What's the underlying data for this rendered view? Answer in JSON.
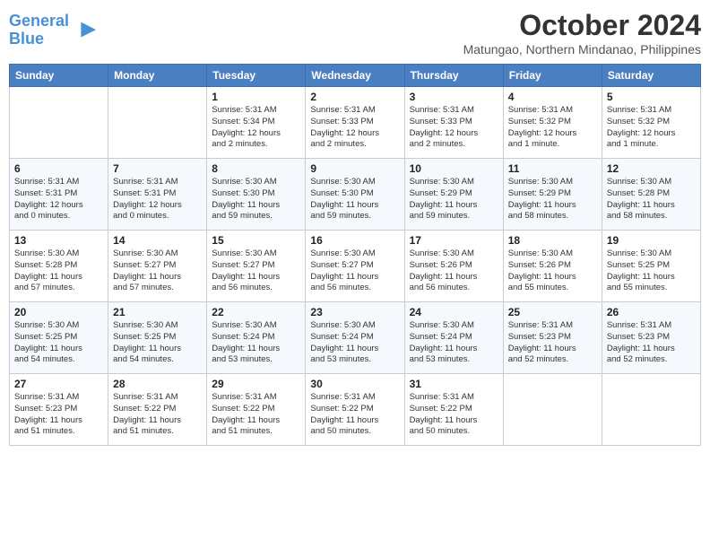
{
  "header": {
    "logo_line1": "General",
    "logo_line2": "Blue",
    "month_year": "October 2024",
    "location": "Matungao, Northern Mindanao, Philippines"
  },
  "days_of_week": [
    "Sunday",
    "Monday",
    "Tuesday",
    "Wednesday",
    "Thursday",
    "Friday",
    "Saturday"
  ],
  "weeks": [
    [
      {
        "day": "",
        "info": ""
      },
      {
        "day": "",
        "info": ""
      },
      {
        "day": "1",
        "info": "Sunrise: 5:31 AM\nSunset: 5:34 PM\nDaylight: 12 hours\nand 2 minutes."
      },
      {
        "day": "2",
        "info": "Sunrise: 5:31 AM\nSunset: 5:33 PM\nDaylight: 12 hours\nand 2 minutes."
      },
      {
        "day": "3",
        "info": "Sunrise: 5:31 AM\nSunset: 5:33 PM\nDaylight: 12 hours\nand 2 minutes."
      },
      {
        "day": "4",
        "info": "Sunrise: 5:31 AM\nSunset: 5:32 PM\nDaylight: 12 hours\nand 1 minute."
      },
      {
        "day": "5",
        "info": "Sunrise: 5:31 AM\nSunset: 5:32 PM\nDaylight: 12 hours\nand 1 minute."
      }
    ],
    [
      {
        "day": "6",
        "info": "Sunrise: 5:31 AM\nSunset: 5:31 PM\nDaylight: 12 hours\nand 0 minutes."
      },
      {
        "day": "7",
        "info": "Sunrise: 5:31 AM\nSunset: 5:31 PM\nDaylight: 12 hours\nand 0 minutes."
      },
      {
        "day": "8",
        "info": "Sunrise: 5:30 AM\nSunset: 5:30 PM\nDaylight: 11 hours\nand 59 minutes."
      },
      {
        "day": "9",
        "info": "Sunrise: 5:30 AM\nSunset: 5:30 PM\nDaylight: 11 hours\nand 59 minutes."
      },
      {
        "day": "10",
        "info": "Sunrise: 5:30 AM\nSunset: 5:29 PM\nDaylight: 11 hours\nand 59 minutes."
      },
      {
        "day": "11",
        "info": "Sunrise: 5:30 AM\nSunset: 5:29 PM\nDaylight: 11 hours\nand 58 minutes."
      },
      {
        "day": "12",
        "info": "Sunrise: 5:30 AM\nSunset: 5:28 PM\nDaylight: 11 hours\nand 58 minutes."
      }
    ],
    [
      {
        "day": "13",
        "info": "Sunrise: 5:30 AM\nSunset: 5:28 PM\nDaylight: 11 hours\nand 57 minutes."
      },
      {
        "day": "14",
        "info": "Sunrise: 5:30 AM\nSunset: 5:27 PM\nDaylight: 11 hours\nand 57 minutes."
      },
      {
        "day": "15",
        "info": "Sunrise: 5:30 AM\nSunset: 5:27 PM\nDaylight: 11 hours\nand 56 minutes."
      },
      {
        "day": "16",
        "info": "Sunrise: 5:30 AM\nSunset: 5:27 PM\nDaylight: 11 hours\nand 56 minutes."
      },
      {
        "day": "17",
        "info": "Sunrise: 5:30 AM\nSunset: 5:26 PM\nDaylight: 11 hours\nand 56 minutes."
      },
      {
        "day": "18",
        "info": "Sunrise: 5:30 AM\nSunset: 5:26 PM\nDaylight: 11 hours\nand 55 minutes."
      },
      {
        "day": "19",
        "info": "Sunrise: 5:30 AM\nSunset: 5:25 PM\nDaylight: 11 hours\nand 55 minutes."
      }
    ],
    [
      {
        "day": "20",
        "info": "Sunrise: 5:30 AM\nSunset: 5:25 PM\nDaylight: 11 hours\nand 54 minutes."
      },
      {
        "day": "21",
        "info": "Sunrise: 5:30 AM\nSunset: 5:25 PM\nDaylight: 11 hours\nand 54 minutes."
      },
      {
        "day": "22",
        "info": "Sunrise: 5:30 AM\nSunset: 5:24 PM\nDaylight: 11 hours\nand 53 minutes."
      },
      {
        "day": "23",
        "info": "Sunrise: 5:30 AM\nSunset: 5:24 PM\nDaylight: 11 hours\nand 53 minutes."
      },
      {
        "day": "24",
        "info": "Sunrise: 5:30 AM\nSunset: 5:24 PM\nDaylight: 11 hours\nand 53 minutes."
      },
      {
        "day": "25",
        "info": "Sunrise: 5:31 AM\nSunset: 5:23 PM\nDaylight: 11 hours\nand 52 minutes."
      },
      {
        "day": "26",
        "info": "Sunrise: 5:31 AM\nSunset: 5:23 PM\nDaylight: 11 hours\nand 52 minutes."
      }
    ],
    [
      {
        "day": "27",
        "info": "Sunrise: 5:31 AM\nSunset: 5:23 PM\nDaylight: 11 hours\nand 51 minutes."
      },
      {
        "day": "28",
        "info": "Sunrise: 5:31 AM\nSunset: 5:22 PM\nDaylight: 11 hours\nand 51 minutes."
      },
      {
        "day": "29",
        "info": "Sunrise: 5:31 AM\nSunset: 5:22 PM\nDaylight: 11 hours\nand 51 minutes."
      },
      {
        "day": "30",
        "info": "Sunrise: 5:31 AM\nSunset: 5:22 PM\nDaylight: 11 hours\nand 50 minutes."
      },
      {
        "day": "31",
        "info": "Sunrise: 5:31 AM\nSunset: 5:22 PM\nDaylight: 11 hours\nand 50 minutes."
      },
      {
        "day": "",
        "info": ""
      },
      {
        "day": "",
        "info": ""
      }
    ]
  ]
}
